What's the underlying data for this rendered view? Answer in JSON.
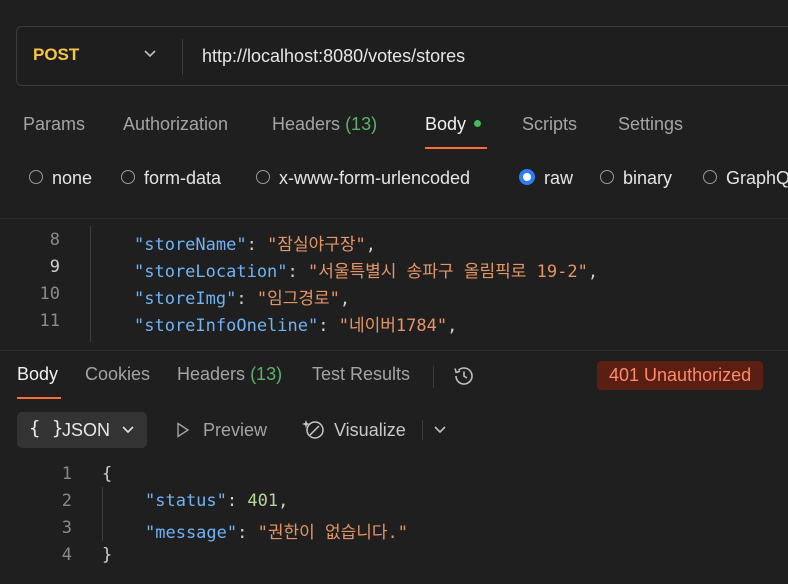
{
  "request": {
    "method": "POST",
    "url": "http://localhost:8080/votes/stores"
  },
  "request_tabs": [
    {
      "label": "Params"
    },
    {
      "label": "Authorization"
    },
    {
      "label": "Headers",
      "count": "(13)"
    },
    {
      "label": "Body"
    },
    {
      "label": "Scripts"
    },
    {
      "label": "Settings"
    }
  ],
  "body_types": [
    {
      "label": "none",
      "checked": false
    },
    {
      "label": "form-data",
      "checked": false
    },
    {
      "label": "x-www-form-urlencoded",
      "checked": false
    },
    {
      "label": "raw",
      "checked": true
    },
    {
      "label": "binary",
      "checked": false
    },
    {
      "label": "GraphQL",
      "checked": false
    }
  ],
  "request_body_lines": [
    {
      "num": "8",
      "key": "\"storeName\"",
      "value": "\"잠실야구장\""
    },
    {
      "num": "9",
      "key": "\"storeLocation\"",
      "value": "\"서울특별시 송파구 올림픽로 19-2\""
    },
    {
      "num": "10",
      "key": "\"storeImg\"",
      "value": "\"임그경로\""
    },
    {
      "num": "11",
      "key": "\"storeInfoOneline\"",
      "value": "\"네이버1784\""
    }
  ],
  "response_tabs": [
    {
      "label": "Body"
    },
    {
      "label": "Cookies"
    },
    {
      "label": "Headers",
      "count": "(13)"
    },
    {
      "label": "Test Results"
    }
  ],
  "response_status": "401 Unauthorized",
  "view_bar": {
    "format": "JSON",
    "braces": "{ }",
    "preview": "Preview",
    "visualize": "Visualize"
  },
  "response_body": {
    "open": "{",
    "close": "}",
    "lines": [
      {
        "num": "1"
      },
      {
        "num": "2",
        "key": "\"status\"",
        "value": "401"
      },
      {
        "num": "3",
        "key": "\"message\"",
        "value": "\"권한이 없습니다.\""
      },
      {
        "num": "4"
      }
    ]
  },
  "colors": {
    "method": "#f5c445",
    "accent": "#ff6c37",
    "status_bg": "#5a1e12",
    "status_text": "#ff8a6a",
    "json_key": "#6fb3f5",
    "json_string": "#e69567"
  }
}
